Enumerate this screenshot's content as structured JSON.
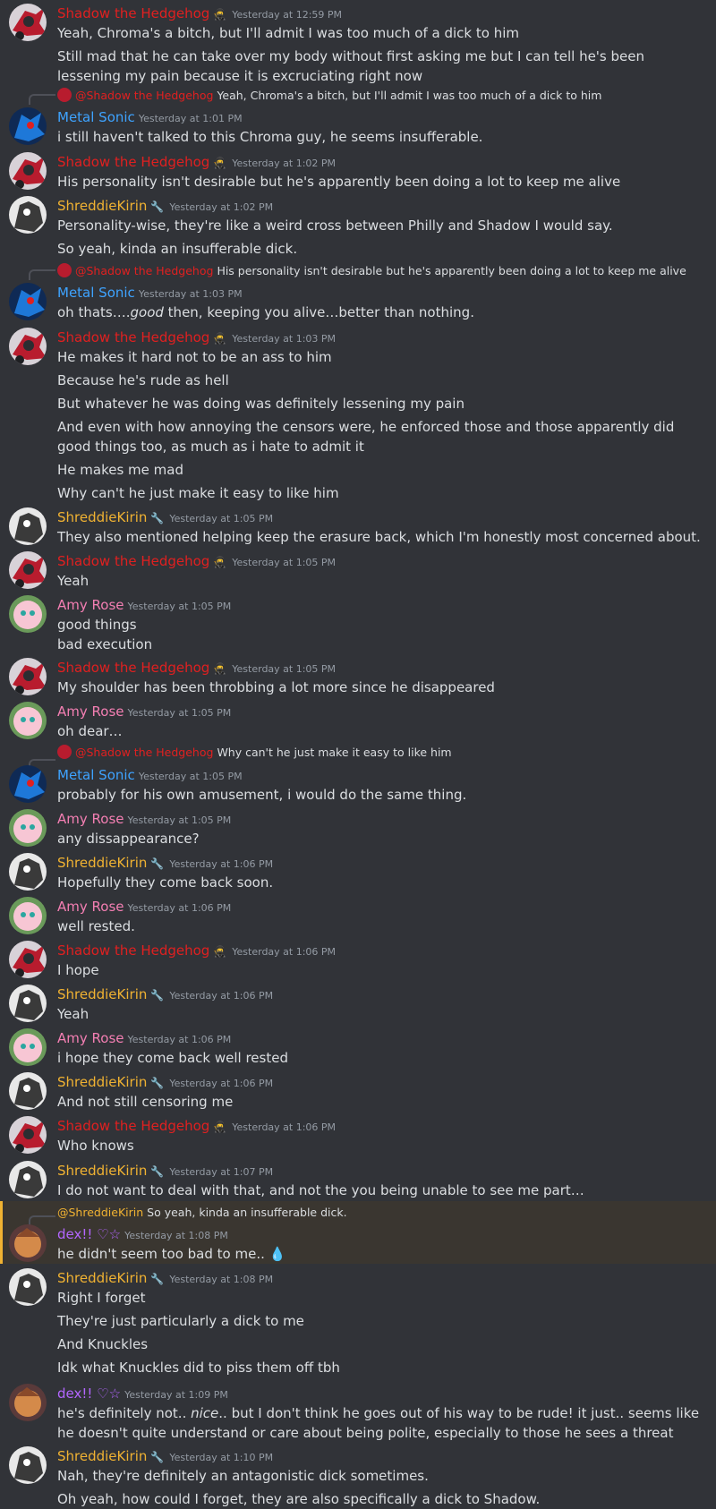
{
  "users": {
    "shadow": {
      "name": "Shadow the Hedgehog",
      "color": "#e02020",
      "tag_icon": "badge-face-icon"
    },
    "metal": {
      "name": "Metal Sonic",
      "color": "#3ea3ff"
    },
    "shreddie": {
      "name": "ShreddieKirin",
      "color": "#f0b232",
      "tag_icon": "wrench-icon"
    },
    "amy": {
      "name": "Amy Rose",
      "color": "#f47fb3"
    },
    "dex": {
      "name": "dex!! ♡☆",
      "color": "#b366ff"
    }
  },
  "groups": [
    {
      "user": "Shadow the Hedgehog",
      "time": "Yesterday at 12:59 PM",
      "messages": [
        "Yeah, Chroma's a bitch, but I'll admit I was too much of a dick to him",
        "Still mad that he can take over my body without first asking me but I can tell he's been lessening my pain because it is excruciating right now"
      ]
    },
    {
      "reply_to": "@Shadow the Hedgehog",
      "reply_text": "Yeah, Chroma's a bitch, but I'll admit I was too much of a dick to him",
      "user": "Metal Sonic",
      "time": "Yesterday at 1:01 PM",
      "messages": [
        "i still haven't talked to this Chroma guy, he seems insufferable."
      ]
    },
    {
      "user": "Shadow the Hedgehog",
      "time": "Yesterday at 1:02 PM",
      "messages": [
        "His personality isn't desirable but he's apparently been doing a lot to keep me alive"
      ]
    },
    {
      "user": "ShreddieKirin",
      "time": "Yesterday at 1:02 PM",
      "messages": [
        "Personality-wise, they're like a weird cross between Philly and Shadow I would say.",
        "So yeah, kinda an insufferable dick."
      ]
    },
    {
      "reply_to": "@Shadow the Hedgehog",
      "reply_text": "His personality isn't desirable but he's apparently been doing a lot to keep me alive",
      "user": "Metal Sonic",
      "time": "Yesterday at 1:03 PM",
      "messages": [
        "oh thats….good then, keeping you alive…better than nothing."
      ]
    },
    {
      "user": "Shadow the Hedgehog",
      "time": "Yesterday at 1:03 PM",
      "messages": [
        "He makes it hard not to be an ass to him",
        "Because he's rude as hell",
        "But whatever he was doing was definitely lessening my pain",
        "And even with how annoying the censors were, he enforced those and those apparently did good things too, as much as i hate to admit it",
        "He makes me mad",
        "Why can't he just make it easy to like him"
      ]
    },
    {
      "user": "ShreddieKirin",
      "time": "Yesterday at 1:05 PM",
      "messages": [
        "They also mentioned helping keep the erasure back, which I'm honestly most concerned about."
      ]
    },
    {
      "user": "Shadow the Hedgehog",
      "time": "Yesterday at 1:05 PM",
      "messages": [
        "Yeah"
      ]
    },
    {
      "user": "Amy Rose",
      "time": "Yesterday at 1:05 PM",
      "messages": [
        "good things",
        "bad execution"
      ]
    },
    {
      "user": "Shadow the Hedgehog",
      "time": "Yesterday at 1:05 PM",
      "messages": [
        "My shoulder has been throbbing a lot more since he disappeared"
      ]
    },
    {
      "user": "Amy Rose",
      "time": "Yesterday at 1:05 PM",
      "messages": [
        "oh dear…"
      ]
    },
    {
      "reply_to": "@Shadow the Hedgehog",
      "reply_text": "Why can't he just make it easy to like him",
      "user": "Metal Sonic",
      "time": "Yesterday at 1:05 PM",
      "messages": [
        "probably for his own amusement, i would do the same thing."
      ]
    },
    {
      "user": "Amy Rose",
      "time": "Yesterday at 1:05 PM",
      "messages": [
        "any dissappearance?"
      ]
    },
    {
      "user": "ShreddieKirin",
      "time": "Yesterday at 1:06 PM",
      "messages": [
        "Hopefully they come back soon."
      ]
    },
    {
      "user": "Amy Rose",
      "time": "Yesterday at 1:06 PM",
      "messages": [
        "well rested."
      ]
    },
    {
      "user": "Shadow the Hedgehog",
      "time": "Yesterday at 1:06 PM",
      "messages": [
        "I hope"
      ]
    },
    {
      "user": "ShreddieKirin",
      "time": "Yesterday at 1:06 PM",
      "messages": [
        "Yeah"
      ]
    },
    {
      "user": "Amy Rose",
      "time": "Yesterday at 1:06 PM",
      "messages": [
        "i hope they come back well rested"
      ]
    },
    {
      "user": "ShreddieKirin",
      "time": "Yesterday at 1:06 PM",
      "messages": [
        "And not still censoring me"
      ]
    },
    {
      "user": "Shadow the Hedgehog",
      "time": "Yesterday at 1:06 PM",
      "messages": [
        "Who knows"
      ]
    },
    {
      "user": "ShreddieKirin",
      "time": "Yesterday at 1:07 PM",
      "messages": [
        "I do not want to deal with that, and not the you being unable to see me part…"
      ]
    },
    {
      "reply_to": "@ShreddieKirin",
      "reply_text": "So yeah, kinda an insufferable dick.",
      "user": "dex!! ♡☆",
      "time": "Yesterday at 1:08 PM",
      "messages": [
        "he didn't seem too bad to me.. 💧"
      ]
    },
    {
      "user": "ShreddieKirin",
      "time": "Yesterday at 1:08 PM",
      "messages": [
        "Right I forget",
        "They're just particularly a dick to me",
        "And Knuckles",
        "Idk what Knuckles did to piss them off tbh"
      ]
    },
    {
      "user": "dex!! ♡☆",
      "time": "Yesterday at 1:09 PM",
      "messages": [
        "he's definitely not.. nice.. but I don't think he goes out of his way to be rude! it just.. seems like he doesn't quite understand or care about being polite, especially to those he sees a threat"
      ]
    },
    {
      "user": "ShreddieKirin",
      "time": "Yesterday at 1:10 PM",
      "messages": [
        "Nah, they're definitely an antagonistic dick sometimes.",
        "Oh yeah, how could I forget, they are also specifically a dick to Shadow."
      ]
    }
  ]
}
